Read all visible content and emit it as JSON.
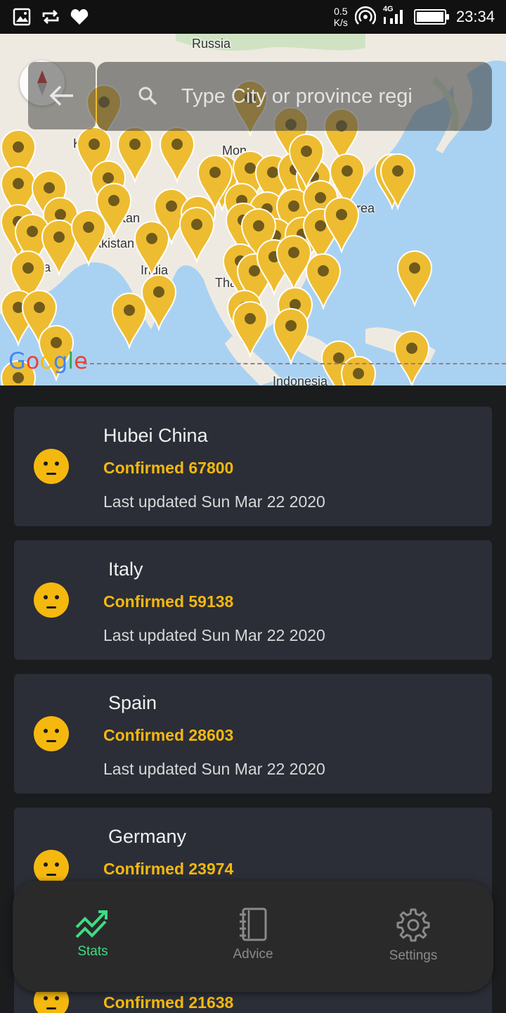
{
  "status_bar": {
    "speed_value": "0.5",
    "speed_unit": "K/s",
    "network": "4G",
    "time": "23:34"
  },
  "map": {
    "labels": [
      "Russia",
      "K",
      "Mon",
      "Afghanistan",
      "Pakistan",
      "rabia",
      "India",
      "Tha",
      "h Korea",
      "Indonesia"
    ],
    "google_text": "Google",
    "colors": {
      "water": "#a9d2f2",
      "land": "#efeae1",
      "pin": "#eebc30",
      "pin_dot": "#6f5a1c"
    }
  },
  "search": {
    "placeholder": "Type City or province regi",
    "back_icon": "arrow-left-icon",
    "search_icon": "search-icon"
  },
  "list": {
    "items": [
      {
        "name": "Hubei China",
        "confirmed": "Confirmed 67800",
        "updated": "Last updated Sun Mar 22 2020"
      },
      {
        "name": "Italy",
        "confirmed": "Confirmed 59138",
        "updated": "Last updated Sun Mar 22 2020"
      },
      {
        "name": "Spain",
        "confirmed": "Confirmed 28603",
        "updated": "Last updated Sun Mar 22 2020"
      },
      {
        "name": "Germany",
        "confirmed": "Confirmed 23974",
        "updated": ""
      },
      {
        "name": "",
        "confirmed": "Confirmed 21638",
        "updated": ""
      }
    ]
  },
  "nav": {
    "items": [
      {
        "label": "Stats",
        "icon": "trending-up-icon",
        "active": true
      },
      {
        "label": "Advice",
        "icon": "notebook-icon",
        "active": false
      },
      {
        "label": "Settings",
        "icon": "gear-icon",
        "active": false
      }
    ],
    "colors": {
      "active": "#3ddc84",
      "inactive": "#8a8a8a"
    }
  }
}
